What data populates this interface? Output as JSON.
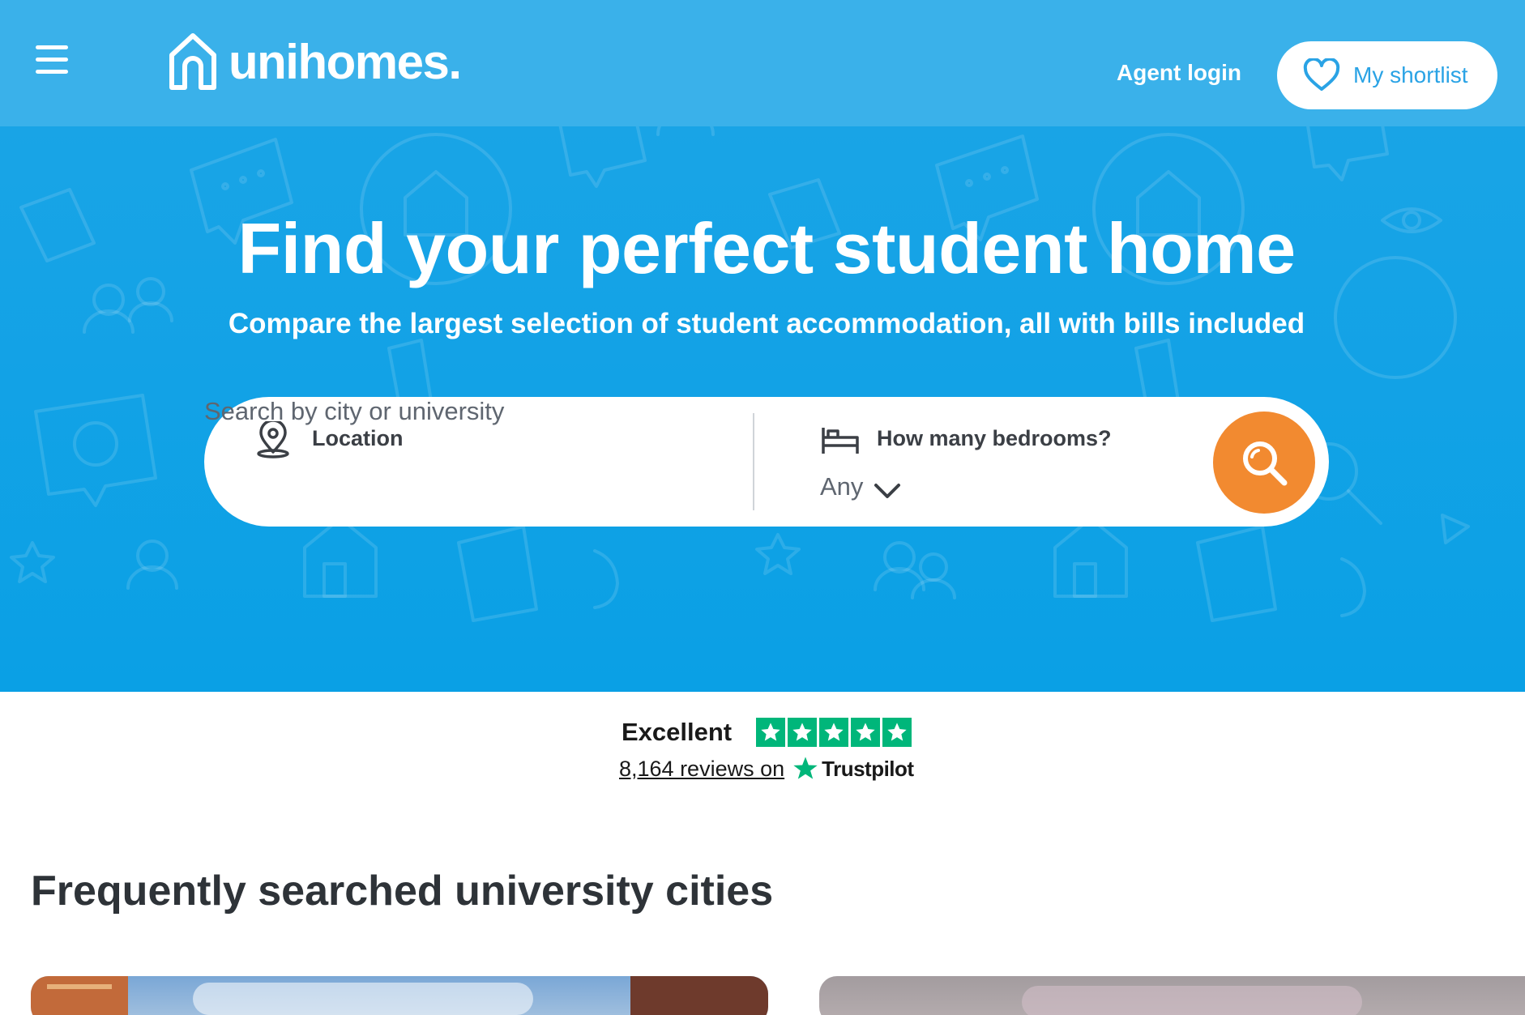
{
  "header": {
    "logo_text": "unihomes.",
    "agent_login": "Agent login",
    "shortlist_label": "My shortlist"
  },
  "hero": {
    "title": "Find your perfect student home",
    "subtitle": "Compare the largest selection of student accommodation, all with bills included"
  },
  "search": {
    "location_label": "Location",
    "location_placeholder": "Search by city or university",
    "bedrooms_label": "How many bedrooms?",
    "bedrooms_value": "Any"
  },
  "trustpilot": {
    "rating_text": "Excellent",
    "stars": 5,
    "reviews_text": "8,164 reviews on",
    "brand": "Trustpilot"
  },
  "cities_section": {
    "title": "Frequently searched university cities"
  },
  "colors": {
    "header_bg": "#3ab1ea",
    "hero_bg": "#0aa0e5",
    "accent_orange": "#f28a30",
    "shortlist_blue": "#2aa3e5",
    "trustpilot_green": "#00b67a"
  },
  "icons": {
    "menu": "hamburger-icon",
    "logo": "house-outline-icon",
    "shortlist": "heart-icon",
    "location": "map-pin-icon",
    "bedrooms": "bed-icon",
    "dropdown": "chevron-down-icon",
    "search": "search-icon",
    "star": "star-icon"
  }
}
